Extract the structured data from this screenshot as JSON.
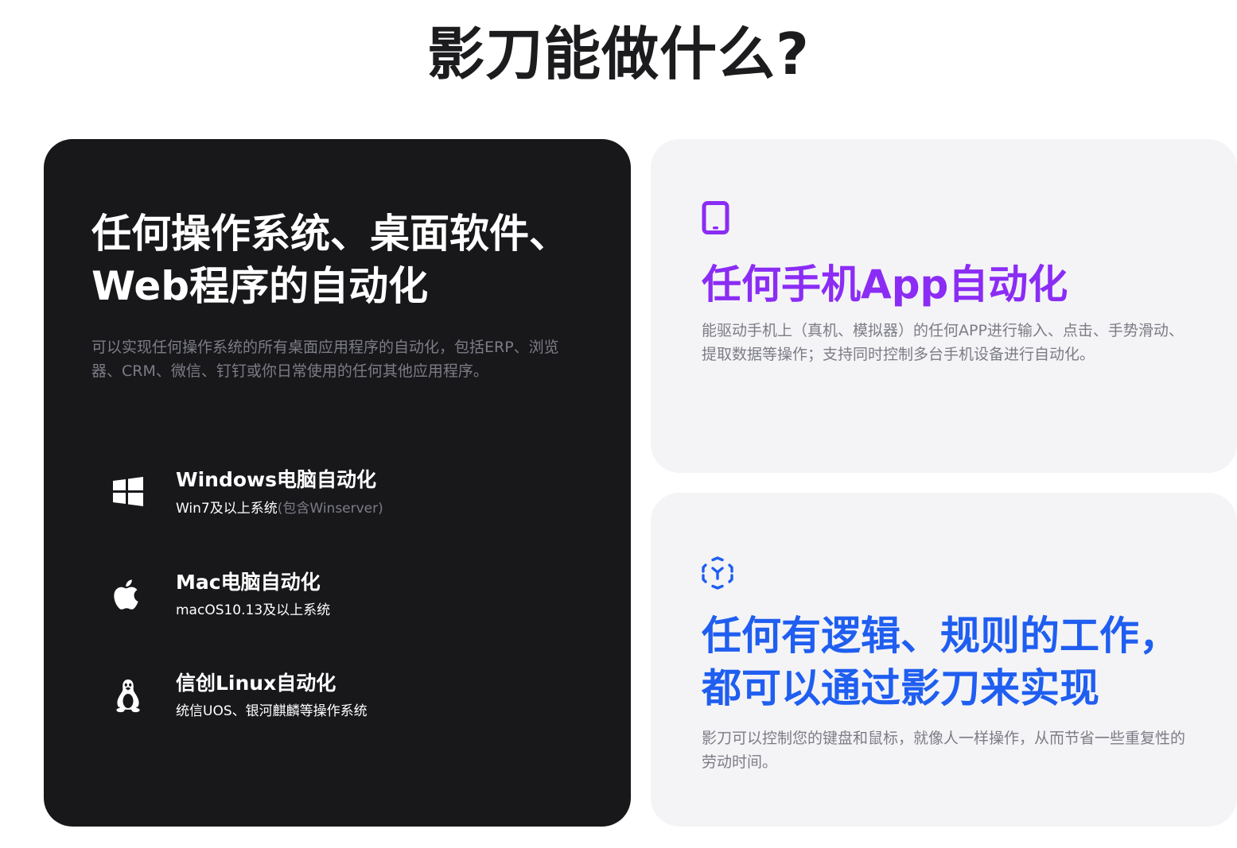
{
  "header": {
    "title": "影刀能做什么?"
  },
  "desktop_card": {
    "title_line1": "任何操作系统、桌面软件、",
    "title_line2": "Web程序的自动化",
    "description": "可以实现任何操作系统的所有桌面应用程序的自动化，包括ERP、浏览器、CRM、微信、钉钉或你日常使用的任何其他应用程序。",
    "items": [
      {
        "icon": "windows-icon",
        "title": "Windows电脑自动化",
        "subtitle": "Win7及以上系统",
        "subtitle_muted": "(包含Winserver)"
      },
      {
        "icon": "apple-icon",
        "title": "Mac电脑自动化",
        "subtitle": "macOS10.13及以上系统",
        "subtitle_muted": ""
      },
      {
        "icon": "linux-icon",
        "title": "信创Linux自动化",
        "subtitle": "统信UOS、银河麒麟等操作系统",
        "subtitle_muted": ""
      }
    ]
  },
  "mobile_card": {
    "icon": "tablet-icon",
    "title": "任何手机App自动化",
    "description": "能驱动手机上（真机、模拟器）的任何APP进行输入、点击、手势滑动、提取数据等操作；支持同时控制多台手机设备进行自动化。",
    "accent_color": "#8b2cf5"
  },
  "logic_card": {
    "icon": "scan-frame-icon",
    "title_line1": "任何有逻辑、规则的工作，",
    "title_line2": "都可以通过影刀来实现",
    "description": "影刀可以控制您的键盘和鼠标，就像人一样操作，从而节省一些重复性的劳动时间。",
    "accent_color": "#1f5ef0"
  }
}
